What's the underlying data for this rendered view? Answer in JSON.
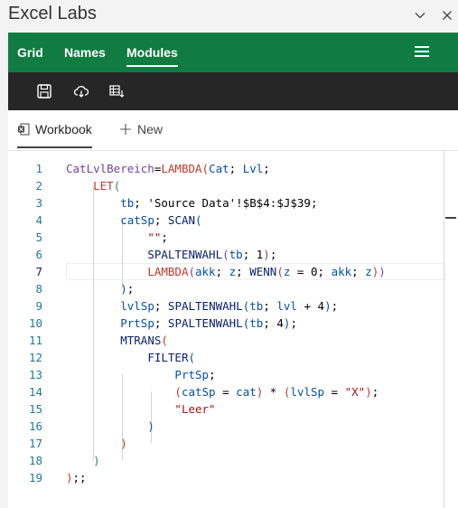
{
  "window": {
    "title": "Excel Labs",
    "collapse_icon": "chevron-down-icon",
    "close_icon": "close-icon"
  },
  "nav": {
    "tabs": [
      {
        "label": "Grid"
      },
      {
        "label": "Names"
      },
      {
        "label": "Modules",
        "active": true
      }
    ],
    "menu_icon": "hamburger-menu-icon"
  },
  "toolbar": {
    "buttons": [
      {
        "icon": "save-icon"
      },
      {
        "icon": "cloud-download-icon"
      },
      {
        "icon": "table-import-icon"
      }
    ]
  },
  "subtabs": {
    "workbook_label": "Workbook",
    "new_label": "New"
  },
  "editor": {
    "current_line": 7,
    "lines": [
      {
        "n": "1",
        "tokens": [
          [
            "CatLvlBereich",
            "c-name"
          ],
          [
            "=",
            "c-text"
          ],
          [
            "LAMBDA",
            "c-fn"
          ],
          [
            "(",
            "c-fn"
          ],
          [
            "Cat",
            "c-blue"
          ],
          [
            "; ",
            "c-text"
          ],
          [
            "Lvl",
            "c-blue"
          ],
          [
            ";",
            "c-text"
          ]
        ]
      },
      {
        "n": "2",
        "tokens": [
          [
            "    ",
            "c-text"
          ],
          [
            "LET",
            "c-fn"
          ],
          [
            "(",
            "c-p2"
          ]
        ]
      },
      {
        "n": "3",
        "tokens": [
          [
            "        ",
            "c-text"
          ],
          [
            "tb",
            "c-blue"
          ],
          [
            "; ",
            "c-text"
          ],
          [
            "'Source Data'!$B$4:$J$39",
            "c-black"
          ],
          [
            ";",
            "c-text"
          ]
        ]
      },
      {
        "n": "4",
        "tokens": [
          [
            "        ",
            "c-text"
          ],
          [
            "catSp",
            "c-blue"
          ],
          [
            "; ",
            "c-text"
          ],
          [
            "SCAN",
            "c-dark"
          ],
          [
            "(",
            "c-p3"
          ]
        ]
      },
      {
        "n": "5",
        "tokens": [
          [
            "            ",
            "c-text"
          ],
          [
            "\"\"",
            "c-str"
          ],
          [
            ";",
            "c-text"
          ]
        ]
      },
      {
        "n": "6",
        "tokens": [
          [
            "            ",
            "c-text"
          ],
          [
            "SPALTENWAHL",
            "c-dark"
          ],
          [
            "(",
            "c-p4"
          ],
          [
            "tb",
            "c-blue"
          ],
          [
            "; ",
            "c-text"
          ],
          [
            "1",
            "c-text"
          ],
          [
            ")",
            "c-p4"
          ],
          [
            ";",
            "c-text"
          ]
        ]
      },
      {
        "n": "7",
        "tokens": [
          [
            "            ",
            "c-text"
          ],
          [
            "LAMBDA",
            "c-fn"
          ],
          [
            "(",
            "c-p4"
          ],
          [
            "akk",
            "c-blue"
          ],
          [
            "; ",
            "c-text"
          ],
          [
            "z",
            "c-blue"
          ],
          [
            "; ",
            "c-text"
          ],
          [
            "WENN",
            "c-dark"
          ],
          [
            "(",
            "c-p1"
          ],
          [
            "z",
            "c-blue"
          ],
          [
            " = ",
            "c-text"
          ],
          [
            "0",
            "c-text"
          ],
          [
            "; ",
            "c-text"
          ],
          [
            "akk",
            "c-blue"
          ],
          [
            "; ",
            "c-text"
          ],
          [
            "z",
            "c-blue"
          ],
          [
            ")",
            "c-p1"
          ],
          [
            ")",
            "c-p4"
          ]
        ]
      },
      {
        "n": "8",
        "tokens": [
          [
            "        ",
            "c-text"
          ],
          [
            ")",
            "c-p3"
          ],
          [
            ";",
            "c-text"
          ]
        ]
      },
      {
        "n": "9",
        "tokens": [
          [
            "        ",
            "c-text"
          ],
          [
            "lvlSp",
            "c-blue"
          ],
          [
            "; ",
            "c-text"
          ],
          [
            "SPALTENWAHL",
            "c-dark"
          ],
          [
            "(",
            "c-p3"
          ],
          [
            "tb",
            "c-blue"
          ],
          [
            "; ",
            "c-text"
          ],
          [
            "lvl",
            "c-blue"
          ],
          [
            " + ",
            "c-text"
          ],
          [
            "4",
            "c-text"
          ],
          [
            ")",
            "c-p3"
          ],
          [
            ";",
            "c-text"
          ]
        ]
      },
      {
        "n": "10",
        "tokens": [
          [
            "        ",
            "c-text"
          ],
          [
            "PrtSp",
            "c-blue"
          ],
          [
            "; ",
            "c-text"
          ],
          [
            "SPALTENWAHL",
            "c-dark"
          ],
          [
            "(",
            "c-p3"
          ],
          [
            "tb",
            "c-blue"
          ],
          [
            "; ",
            "c-text"
          ],
          [
            "4",
            "c-text"
          ],
          [
            ")",
            "c-p3"
          ],
          [
            ";",
            "c-text"
          ]
        ]
      },
      {
        "n": "11",
        "tokens": [
          [
            "        ",
            "c-text"
          ],
          [
            "MTRANS",
            "c-dark"
          ],
          [
            "(",
            "c-p1"
          ]
        ]
      },
      {
        "n": "12",
        "tokens": [
          [
            "            ",
            "c-text"
          ],
          [
            "FILTER",
            "c-dark"
          ],
          [
            "(",
            "c-p3"
          ]
        ]
      },
      {
        "n": "13",
        "tokens": [
          [
            "                ",
            "c-text"
          ],
          [
            "PrtSp",
            "c-blue"
          ],
          [
            ";",
            "c-text"
          ]
        ]
      },
      {
        "n": "14",
        "tokens": [
          [
            "                ",
            "c-text"
          ],
          [
            "(",
            "c-p1"
          ],
          [
            "catSp",
            "c-blue"
          ],
          [
            " = ",
            "c-text"
          ],
          [
            "cat",
            "c-blue"
          ],
          [
            ")",
            "c-p1"
          ],
          [
            " * ",
            "c-text"
          ],
          [
            "(",
            "c-p1"
          ],
          [
            "lvlSp",
            "c-blue"
          ],
          [
            " = ",
            "c-text"
          ],
          [
            "\"X\"",
            "c-str"
          ],
          [
            ")",
            "c-p1"
          ],
          [
            ";",
            "c-text"
          ]
        ]
      },
      {
        "n": "15",
        "tokens": [
          [
            "                ",
            "c-text"
          ],
          [
            "\"Leer\"",
            "c-str"
          ]
        ]
      },
      {
        "n": "16",
        "tokens": [
          [
            "            ",
            "c-text"
          ],
          [
            ")",
            "c-p3"
          ]
        ]
      },
      {
        "n": "17",
        "tokens": [
          [
            "        ",
            "c-text"
          ],
          [
            ")",
            "c-p1"
          ]
        ]
      },
      {
        "n": "18",
        "tokens": [
          [
            "    ",
            "c-text"
          ],
          [
            ")",
            "c-p2"
          ]
        ]
      },
      {
        "n": "19",
        "tokens": [
          [
            ")",
            "c-fn"
          ],
          [
            ";;",
            "c-text"
          ]
        ]
      }
    ]
  }
}
